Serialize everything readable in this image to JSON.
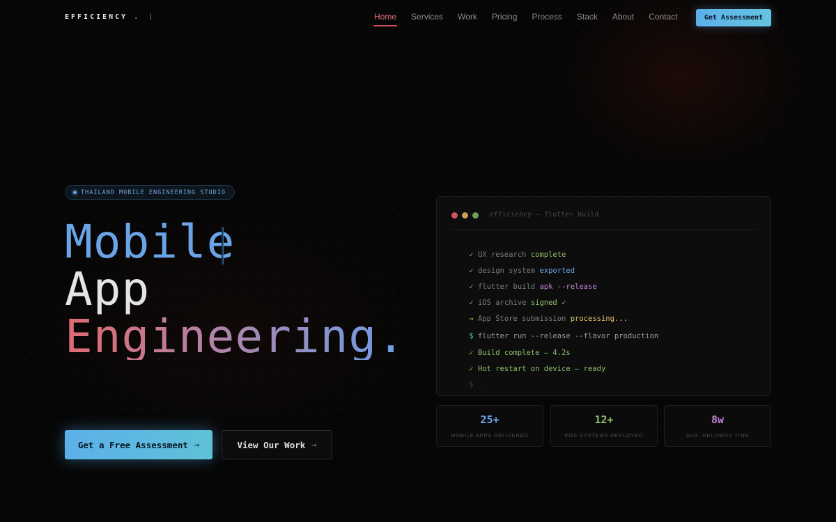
{
  "nav": {
    "brand": "EFFICIENCY",
    "brand_dot": ".",
    "brand_caret": "|",
    "links": [
      {
        "label": "Home",
        "active": true
      },
      {
        "label": "Services"
      },
      {
        "label": "Work"
      },
      {
        "label": "Pricing"
      },
      {
        "label": "Process"
      },
      {
        "label": "Stack"
      },
      {
        "label": "About"
      },
      {
        "label": "Contact"
      }
    ],
    "cta_label": "Get Assessment"
  },
  "hero": {
    "badge": "THAILAND MOBILE ENGINEERING STUDIO",
    "line1": "Mobile",
    "line2": "App",
    "line3": "Engineering.",
    "primary_button": "Get a Free Assessment",
    "secondary_button": "View Our Work",
    "arrow": "→"
  },
  "terminal": {
    "title": "efficiency — flutter build",
    "lines": [
      {
        "prefix": "✓",
        "text": "UX research",
        "highlight": "complete"
      },
      {
        "prefix": "✓",
        "text": "design system",
        "highlight": "exported"
      },
      {
        "prefix": "✓",
        "text": "flutter build",
        "highlight": "apk --release"
      },
      {
        "prefix": "✓",
        "text": "iOS archive",
        "highlight": "signed ✓"
      },
      {
        "prefix": "→",
        "text": "App Store submission",
        "highlight": "processing..."
      },
      {
        "prefix": "$",
        "text": "flutter run --release --flavor production"
      },
      {
        "prefix": "✓",
        "text": "Build complete — 4.2s"
      },
      {
        "prefix": "✓",
        "text": "Hot restart on device — ready"
      },
      {
        "prefix": "$",
        "text": "_"
      }
    ]
  },
  "stats": [
    {
      "value": "25+",
      "label": "MOBILE APPS DELIVERED",
      "color": "#6aa4e6"
    },
    {
      "value": "12+",
      "label": "POS SYSTEMS DEPLOYED",
      "color": "#8fbf6a"
    },
    {
      "value": "8w",
      "label": "AVG. DELIVERY TIME",
      "color": "#c080d0"
    }
  ],
  "colors": {
    "accent_blue": "#5cb0ea",
    "accent_red": "#d0505a",
    "dot_red": "#d0555c",
    "dot_yellow": "#c8a050",
    "dot_green": "#6aa060"
  }
}
